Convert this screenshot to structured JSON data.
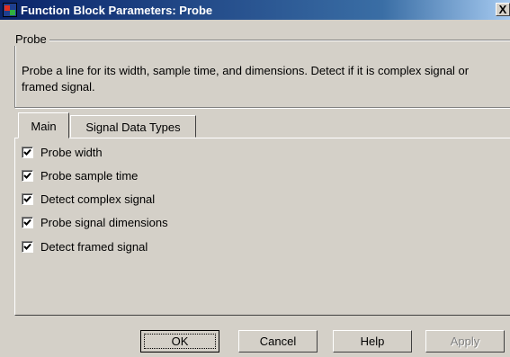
{
  "window": {
    "title": "Function Block Parameters: Probe",
    "close_label": "X"
  },
  "group": {
    "legend": "Probe",
    "description": "Probe a line for its width, sample time, and dimensions. Detect if it is complex signal or framed signal."
  },
  "tabs": [
    {
      "label": "Main",
      "active": true
    },
    {
      "label": "Signal Data Types",
      "active": false
    }
  ],
  "options": [
    {
      "label": "Probe width",
      "checked": true
    },
    {
      "label": "Probe sample time",
      "checked": true
    },
    {
      "label": "Detect complex signal",
      "checked": true
    },
    {
      "label": "Probe signal dimensions",
      "checked": true
    },
    {
      "label": "Detect framed signal",
      "checked": true
    }
  ],
  "buttons": {
    "ok": "OK",
    "cancel": "Cancel",
    "help": "Help",
    "apply": "Apply"
  }
}
